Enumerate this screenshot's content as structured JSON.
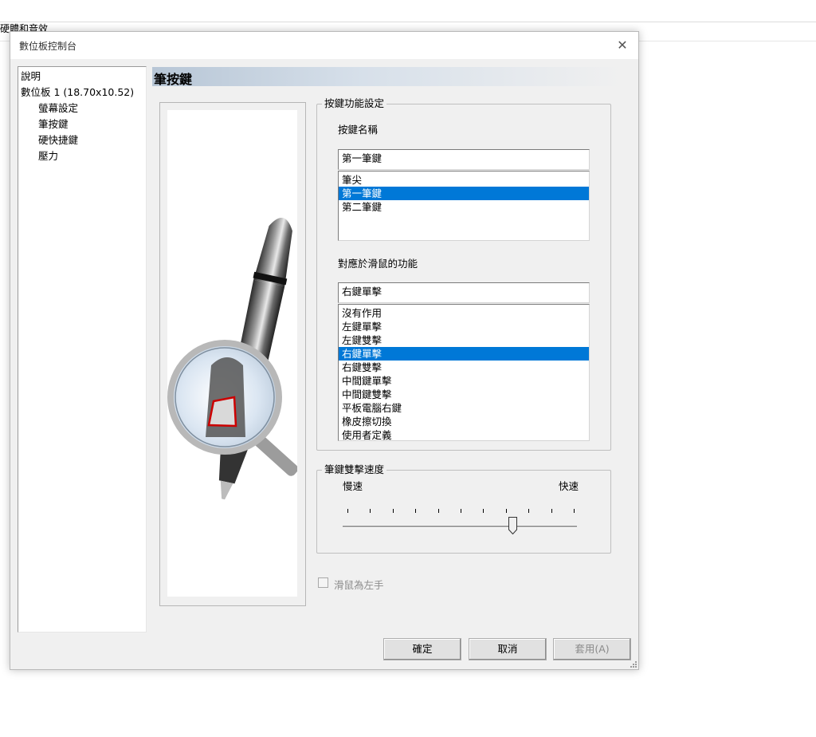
{
  "background": {
    "window_title": "硬體和音效"
  },
  "dialog": {
    "title": "數位板控制台",
    "close_glyph": "✕",
    "nav": [
      {
        "label": "說明",
        "indent": 0
      },
      {
        "label": "數位板 1 (18.70x10.52)",
        "indent": 0
      },
      {
        "label": "螢幕設定",
        "indent": 1
      },
      {
        "label": "筆按鍵",
        "indent": 1,
        "selected": true
      },
      {
        "label": "硬快捷鍵",
        "indent": 1
      },
      {
        "label": "壓力",
        "indent": 1
      }
    ],
    "section_title": "筆按鍵",
    "key_function": {
      "group_label": "按鍵功能設定",
      "key_name_label": "按鍵名稱",
      "key_name_value": "第一筆鍵",
      "key_list": [
        "筆尖",
        "第一筆鍵",
        "第二筆鍵"
      ],
      "key_list_selected": 1,
      "mouse_func_label": "對應於滑鼠的功能",
      "mouse_func_value": "右鍵單擊",
      "func_list": [
        "沒有作用",
        "左鍵單擊",
        "左鍵雙擊",
        "右鍵單擊",
        "右鍵雙擊",
        "中間鍵單擊",
        "中間鍵雙擊",
        "平板電腦右鍵",
        "橡皮擦切換",
        "使用者定義"
      ],
      "func_list_selected": 3
    },
    "double_click_speed": {
      "group_label": "筆鍵雙擊速度",
      "slow_label": "慢速",
      "fast_label": "快速",
      "tick_count": 11,
      "value_fraction": 0.73
    },
    "left_hand_checkbox": {
      "label": "滑鼠為左手",
      "checked": false,
      "enabled": false
    },
    "buttons": {
      "ok": "確定",
      "cancel": "取消",
      "apply": "套用(A)"
    }
  },
  "colors": {
    "selection": "#0078d7",
    "dialog_bg": "#f0f0f0"
  }
}
